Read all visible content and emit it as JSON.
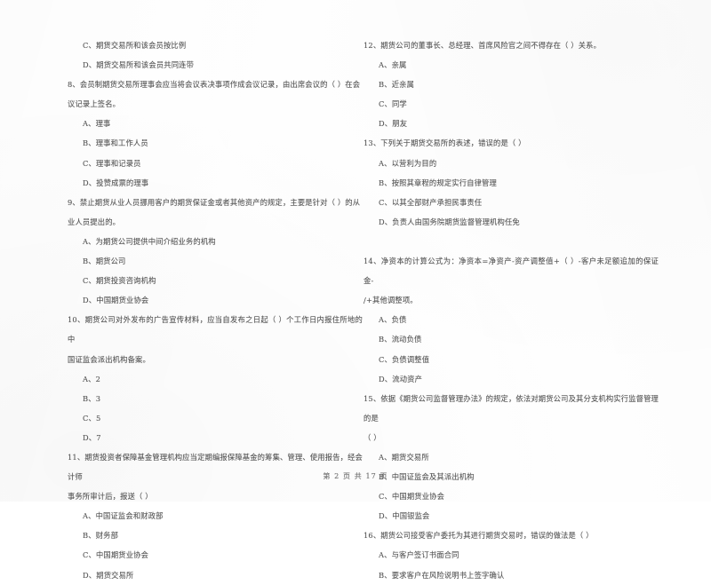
{
  "document": {
    "page_footer": "第 2 页  共 17 页",
    "page_number": "2",
    "total_pages": "17",
    "ink_color": "#565656",
    "background_color": "#ffffff"
  },
  "left_column": {
    "blocks": [
      {
        "type": "option",
        "lines": [
          "C、期货交易所和该会员按比例"
        ]
      },
      {
        "type": "option",
        "lines": [
          "D、期货交易所和该会员共同连带"
        ]
      },
      {
        "type": "stem",
        "number": "8",
        "lines": [
          "8、会员制期货交易所理事会应当将会议表决事项作成会议记录，由出席会议的（      ）在会",
          "议记录上签名。"
        ]
      },
      {
        "type": "option",
        "lines": [
          "A、理事"
        ]
      },
      {
        "type": "option",
        "lines": [
          "B、理事和工作人员"
        ]
      },
      {
        "type": "option",
        "lines": [
          "C、理事和记录员"
        ]
      },
      {
        "type": "option",
        "lines": [
          "D、投赞成票的理事"
        ]
      },
      {
        "type": "stem",
        "number": "9",
        "lines": [
          "9、禁止期货从业人员挪用客户的期货保证金或者其他资产的规定，主要是针对（       ）的从",
          "业人员提出的。"
        ]
      },
      {
        "type": "option",
        "lines": [
          "A、为期货公司提供中间介绍业务的机构"
        ]
      },
      {
        "type": "option",
        "lines": [
          "B、期货公司"
        ]
      },
      {
        "type": "option",
        "lines": [
          "C、期货投资咨询机构"
        ]
      },
      {
        "type": "option",
        "lines": [
          "D、中国期货业协会"
        ]
      },
      {
        "type": "stem",
        "number": "10",
        "lines": [
          "10、期货公司对外发布的广告宣传材料，应当自发布之日起（      ）个工作日内报住所地的中",
          "国证监会派出机构备案。"
        ]
      },
      {
        "type": "option",
        "lines": [
          "A、2"
        ]
      },
      {
        "type": "option",
        "lines": [
          "B、3"
        ]
      },
      {
        "type": "option",
        "lines": [
          "C、5"
        ]
      },
      {
        "type": "option",
        "lines": [
          "D、7"
        ]
      },
      {
        "type": "stem",
        "number": "11",
        "lines": [
          "11、期货投资者保障基金管理机构应当定期编报保障基金的筹集、管理、使用报告，经会计师",
          "事务所审计后，报送（    ）"
        ]
      },
      {
        "type": "option",
        "lines": [
          "A、中国证监会和财政部"
        ]
      },
      {
        "type": "option",
        "lines": [
          "B、财务部"
        ]
      },
      {
        "type": "option",
        "lines": [
          "C、中国期货业协会"
        ]
      },
      {
        "type": "option",
        "lines": [
          "D、期货交易所"
        ]
      }
    ]
  },
  "right_column": {
    "blocks": [
      {
        "type": "stem",
        "number": "12",
        "lines": [
          "12、期货公司的董事长、总经理、首席风险官之间不得存在（     ）关系。"
        ]
      },
      {
        "type": "option",
        "lines": [
          "A、亲属"
        ]
      },
      {
        "type": "option",
        "lines": [
          "B、近亲属"
        ]
      },
      {
        "type": "option",
        "lines": [
          "C、同学"
        ]
      },
      {
        "type": "option",
        "lines": [
          "D、朋友"
        ]
      },
      {
        "type": "stem",
        "number": "13",
        "lines": [
          "13、下列关于期货交易所的表述，错误的是（     ）"
        ]
      },
      {
        "type": "option",
        "lines": [
          "A、以营利为目的"
        ]
      },
      {
        "type": "option",
        "lines": [
          "B、按照其章程的规定实行自律管理"
        ]
      },
      {
        "type": "option",
        "lines": [
          "C、以其全部财产承担民事责任"
        ]
      },
      {
        "type": "option",
        "lines": [
          "D、负责人由国务院期货监督管理机构任免"
        ]
      },
      {
        "type": "gap",
        "lines": []
      },
      {
        "type": "stem",
        "number": "14",
        "lines": [
          "14、净资本的计算公式为：净资本=净资产-资产调整值+（       ）-客户未足额追加的保证金-",
          "/+其他调整项。"
        ]
      },
      {
        "type": "option",
        "lines": [
          "A、负债"
        ]
      },
      {
        "type": "option",
        "lines": [
          "B、流动负债"
        ]
      },
      {
        "type": "option",
        "lines": [
          "C、负债调整值"
        ]
      },
      {
        "type": "option",
        "lines": [
          "D、流动资产"
        ]
      },
      {
        "type": "stem",
        "number": "15",
        "lines": [
          "15、依据《期货公司监督管理办法》的规定，依法对期货公司及其分支机构实行监督管理的是",
          "（    ）"
        ]
      },
      {
        "type": "option",
        "lines": [
          "A、期货交易所"
        ]
      },
      {
        "type": "option",
        "lines": [
          "B、中国证监会及其派出机构"
        ]
      },
      {
        "type": "option",
        "lines": [
          "C、中国期货业协会"
        ]
      },
      {
        "type": "option",
        "lines": [
          "D、中国银监会"
        ]
      },
      {
        "type": "stem",
        "number": "16",
        "lines": [
          "16、期货公司接受客户委托为其进行期货交易时，错误的做法是（      ）"
        ]
      },
      {
        "type": "option",
        "lines": [
          "A、与客户签订书面合同"
        ]
      },
      {
        "type": "option",
        "lines": [
          "B、要求客户在风险说明书上签字确认"
        ]
      }
    ]
  }
}
